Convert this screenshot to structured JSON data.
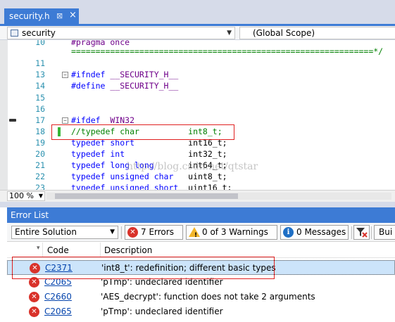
{
  "tab": {
    "title": "security.h",
    "pin": "⊠",
    "close": "×"
  },
  "navbar": {
    "file_scope": "security",
    "global_scope": "(Global Scope)"
  },
  "editor": {
    "lines": [
      {
        "num": "10",
        "parts": [
          {
            "t": "#pragma once",
            "c": "mac"
          }
        ]
      },
      {
        "num": "",
        "parts": [
          {
            "t": "==============================================================*/",
            "c": "cm"
          }
        ]
      },
      {
        "num": "11",
        "parts": []
      },
      {
        "num": "13",
        "fold": "−",
        "parts": [
          {
            "t": "#ifndef ",
            "c": "kw"
          },
          {
            "t": "__SECURITY_H__",
            "c": "mac"
          }
        ]
      },
      {
        "num": "14",
        "parts": [
          {
            "t": "#define ",
            "c": "kw"
          },
          {
            "t": "__SECURITY_H__",
            "c": "mac"
          }
        ]
      },
      {
        "num": "15",
        "parts": []
      },
      {
        "num": "16",
        "parts": []
      },
      {
        "num": "17",
        "fold": "−",
        "parts": [
          {
            "t": "#ifdef ",
            "c": "kw"
          },
          {
            "t": "_WIN32",
            "c": "mac"
          }
        ]
      },
      {
        "num": "18",
        "parts": [
          {
            "t": "//typedef char          int8_t;",
            "c": "cm"
          }
        ]
      },
      {
        "num": "19",
        "parts": [
          {
            "t": "typedef short           ",
            "c": "kw"
          },
          {
            "t": "int16_t;",
            "c": "plain"
          }
        ]
      },
      {
        "num": "20",
        "parts": [
          {
            "t": "typedef int             ",
            "c": "kw"
          },
          {
            "t": "int32_t;",
            "c": "plain"
          }
        ]
      },
      {
        "num": "21",
        "parts": [
          {
            "t": "typedef long long       ",
            "c": "kw"
          },
          {
            "t": "int64_t;",
            "c": "plain"
          }
        ]
      },
      {
        "num": "22",
        "parts": [
          {
            "t": "typedef unsigned char   ",
            "c": "kw"
          },
          {
            "t": "uint8_t;",
            "c": "plain"
          }
        ]
      },
      {
        "num": "23",
        "parts": [
          {
            "t": "typedef unsigned short  ",
            "c": "kw"
          },
          {
            "t": "uint16_t;",
            "c": "plain"
          }
        ]
      }
    ],
    "watermark": "http://blog.csdn.net/qtstar"
  },
  "zoom": {
    "value": "100 %"
  },
  "error_list": {
    "title": "Error List",
    "scope": "Entire Solution",
    "errors_btn": "7 Errors",
    "warnings_btn": "0 of 3 Warnings",
    "messages_btn": "0 Messages",
    "build_btn": "Bui",
    "columns": {
      "code": "Code",
      "description": "Description"
    },
    "rows": [
      {
        "code": "C2371",
        "description": "'int8_t': redefinition; different basic types"
      },
      {
        "code": "C2065",
        "description": "'pTmp': undeclared identifier"
      },
      {
        "code": "C2660",
        "description": "'AES_decrypt': function does not take 2 arguments"
      },
      {
        "code": "C2065",
        "description": "'pTmp': undeclared identifier"
      }
    ]
  }
}
